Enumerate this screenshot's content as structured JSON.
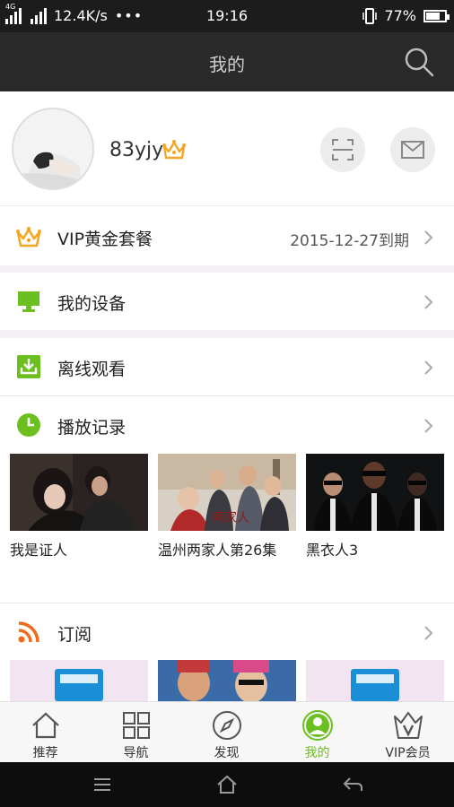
{
  "status_bar": {
    "network_badge": "4G",
    "speed": "12.4K/s",
    "dots": "•••",
    "time": "19:16",
    "battery": "77%",
    "battery_level": 0.77
  },
  "header": {
    "title": "我的"
  },
  "profile": {
    "username": "83yjy"
  },
  "vip_row": {
    "label": "VIP黄金套餐",
    "value": "2015-12-27到期"
  },
  "devices_row": {
    "label": "我的设备"
  },
  "offline_row": {
    "label": "离线观看"
  },
  "history_row": {
    "label": "播放记录",
    "items": [
      {
        "title": "我是证人"
      },
      {
        "title": "温州两家人第26集"
      },
      {
        "title": "黑衣人3"
      }
    ]
  },
  "subscribe_row": {
    "label": "订阅"
  },
  "tabbar": {
    "tabs": [
      {
        "label": "推荐"
      },
      {
        "label": "导航"
      },
      {
        "label": "发现"
      },
      {
        "label": "我的"
      },
      {
        "label": "VIP会员"
      }
    ]
  },
  "colors": {
    "accent_green": "#6bbf1e",
    "crown_orange": "#f5a623",
    "rss_orange": "#f26b1d"
  }
}
